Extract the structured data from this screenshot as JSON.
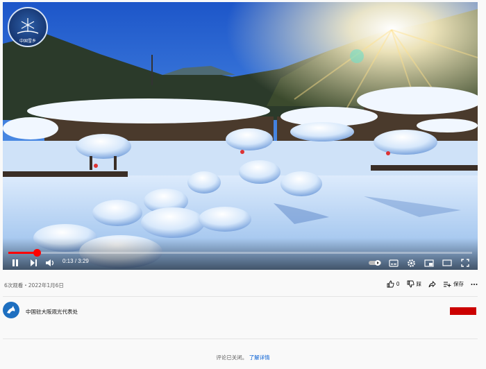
{
  "logo": {
    "text": "CHINA SNOW TOWN",
    "subtext": "中国雪乡"
  },
  "player": {
    "time_current": "0:13",
    "time_total": "3:29",
    "progress": 0.062,
    "icons": [
      "pause-icon",
      "next-icon",
      "volume-icon",
      "autoplay-toggle",
      "subtitles-icon",
      "settings-icon",
      "miniplayer-icon",
      "theater-icon",
      "fullscreen-icon"
    ]
  },
  "video_info": {
    "views": "6次观看",
    "separator": "・",
    "date": "2022年1月6日",
    "like_count": "0",
    "dislike_label": "踩",
    "save_label": "保存"
  },
  "channel": {
    "name": "中国驻大阪观光代表处"
  },
  "comments": {
    "text": "评论已关闭。",
    "link": "了解详情"
  },
  "colors": {
    "accent": "#ff0000",
    "subscribe": "#cc0000",
    "link": "#065fd4"
  }
}
